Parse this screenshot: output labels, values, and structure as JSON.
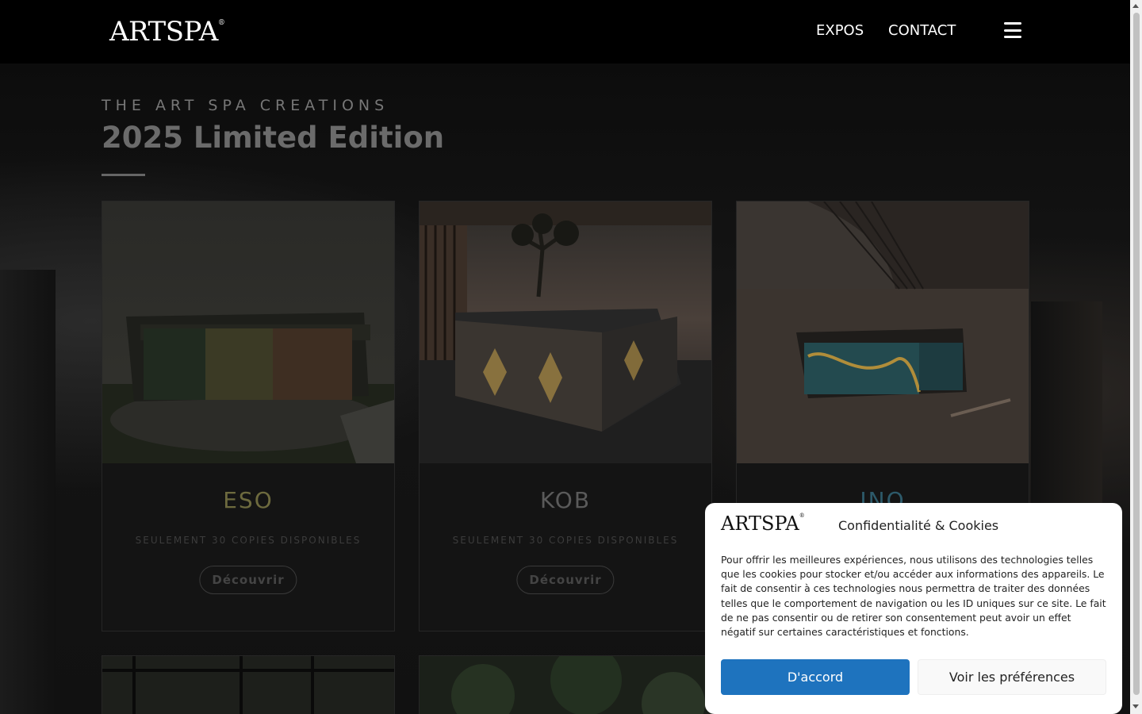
{
  "header": {
    "logo": "ARTSPA",
    "logo_mark": "®",
    "nav": [
      "EXPOS",
      "CONTACT"
    ],
    "menu_icon": "hamburger-icon"
  },
  "section": {
    "eyebrow": "THE ART SPA CREATIONS",
    "title": "2025 Limited Edition"
  },
  "cards": [
    {
      "name": "ESO",
      "subtitle": "SEULEMENT 30 COPIES DISPONIBLES",
      "button": "Découvrir",
      "name_color": "#6d6a3e"
    },
    {
      "name": "KOB",
      "subtitle": "SEULEMENT 30 COPIES DISPONIBLES",
      "button": "Découvrir",
      "name_color": "#5a5a5a"
    },
    {
      "name": "INO",
      "subtitle": "",
      "button": "",
      "name_color": "#2d5a6a"
    }
  ],
  "cookie": {
    "logo": "ARTSPA",
    "logo_mark": "®",
    "title": "Confidentialité & Cookies",
    "text": "Pour offrir les meilleures expériences, nous utilisons des technologies telles que les cookies pour stocker et/ou accéder aux informations des appareils. Le fait de consentir à ces technologies nous permettra de traiter des données telles que le comportement de navigation ou les ID uniques sur ce site. Le fait de ne pas consentir ou de retirer son consentement peut avoir un effet négatif sur certaines caractéristiques et fonctions.",
    "accept": "D'accord",
    "preferences": "Voir les préférences",
    "accent": "#1e73be"
  }
}
